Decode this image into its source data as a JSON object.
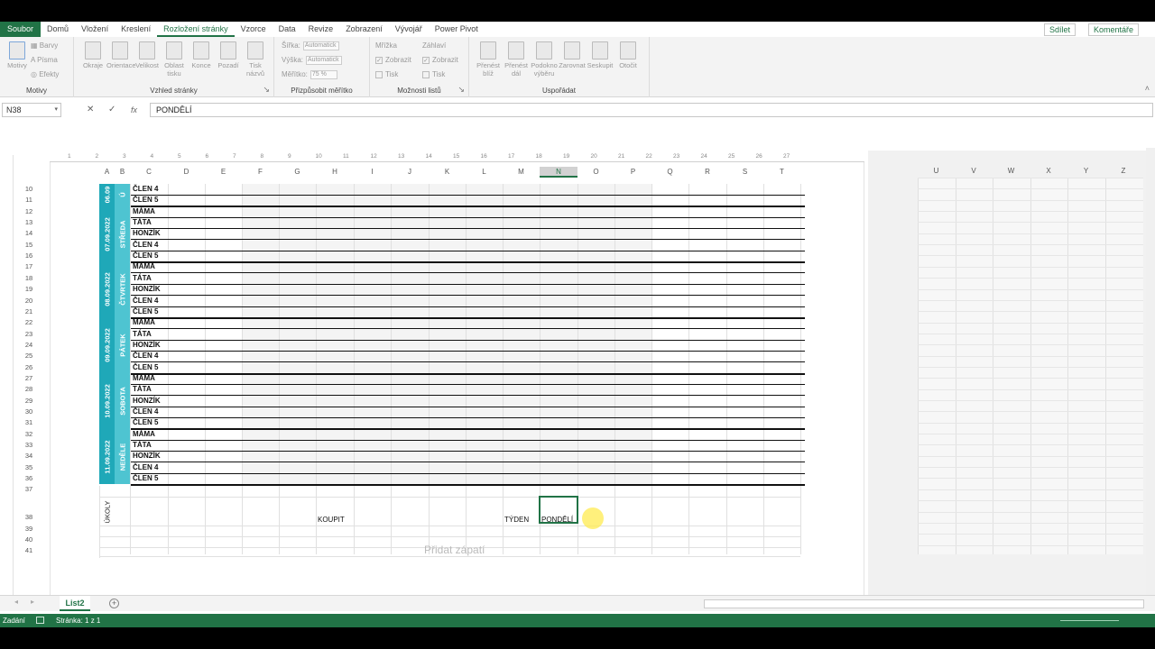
{
  "tabs": [
    "Soubor",
    "Domů",
    "Vložení",
    "Kreslení",
    "Rozložení stránky",
    "Vzorce",
    "Data",
    "Revize",
    "Zobrazení",
    "Vývojář",
    "Power Pivot"
  ],
  "actions": {
    "share": "Sdílet",
    "comments": "Komentáře"
  },
  "ribbon": {
    "motivy": {
      "label": "Motivy",
      "big": "Motivy",
      "colors": "Barvy",
      "fonts": "Písma",
      "effects": "Efekty"
    },
    "vzhled": {
      "label": "Vzhled stránky",
      "buttons": [
        "Okraje",
        "Orientace",
        "Velikost",
        "Oblast tisku",
        "Konce",
        "Pozadí",
        "Tisk názvů"
      ]
    },
    "meritko": {
      "label": "Přizpůsobit měřítko",
      "width": "Šířka:",
      "height": "Výška:",
      "scale": "Měřítko:",
      "auto": "Automatick",
      "scale_val": "75 %"
    },
    "moznosti": {
      "label": "Možnosti listů",
      "grid": "Mřížka",
      "headings": "Záhlaví",
      "view": "Zobrazit",
      "print": "Tisk"
    },
    "usporadat": {
      "label": "Uspořádat",
      "buttons": [
        "Přenést blíž",
        "Přenést dál",
        "Podokno výběru",
        "Zarovnat",
        "Seskupit",
        "Otočit"
      ]
    }
  },
  "formula": {
    "namebox": "N38",
    "content": "PONDĚLÍ",
    "cancel": "✕",
    "enter": "✓",
    "fx": "fx"
  },
  "columns": [
    "A",
    "B",
    "C",
    "D",
    "E",
    "F",
    "G",
    "H",
    "I",
    "J",
    "K",
    "L",
    "M",
    "N",
    "O",
    "P",
    "Q",
    "R",
    "S",
    "T"
  ],
  "right_columns": [
    "U",
    "V",
    "W",
    "X",
    "Y",
    "Z"
  ],
  "rows": [
    "10",
    "11",
    "12",
    "13",
    "14",
    "15",
    "16",
    "17",
    "18",
    "19",
    "20",
    "21",
    "22",
    "23",
    "24",
    "25",
    "26",
    "27",
    "28",
    "29",
    "30",
    "31",
    "32",
    "33",
    "34",
    "35",
    "36",
    "37",
    "38",
    "39",
    "40",
    "41"
  ],
  "ruler": [
    "1",
    "2",
    "3",
    "4",
    "5",
    "6",
    "7",
    "8",
    "9",
    "10",
    "11",
    "12",
    "13",
    "14",
    "15",
    "16",
    "17",
    "18",
    "19",
    "20",
    "21",
    "22",
    "23",
    "24",
    "25",
    "26",
    "27"
  ],
  "days": [
    {
      "date": "06.09",
      "name": "Ú",
      "members": [
        "ČLEN 4",
        "ČLEN 5"
      ]
    },
    {
      "date": "07.09.2022",
      "name": "STŘEDA",
      "members": [
        "MÁMA",
        "TÁTA",
        "HONZÍK",
        "ČLEN 4",
        "ČLEN 5"
      ]
    },
    {
      "date": "08.09.2022",
      "name": "ČTVRTEK",
      "members": [
        "MÁMA",
        "TÁTA",
        "HONZÍK",
        "ČLEN 4",
        "ČLEN 5"
      ]
    },
    {
      "date": "09.09.2022",
      "name": "PÁTEK",
      "members": [
        "MÁMA",
        "TÁTA",
        "HONZÍK",
        "ČLEN 4",
        "ČLEN 5"
      ]
    },
    {
      "date": "10.09.2022",
      "name": "SOBOTA",
      "members": [
        "MÁMA",
        "TÁTA",
        "HONZÍK",
        "ČLEN 4",
        "ČLEN 5"
      ]
    },
    {
      "date": "11.09.2022",
      "name": "NEDĚLE",
      "members": [
        "MÁMA",
        "TÁTA",
        "HONZÍK",
        "ČLEN 4",
        "ČLEN 5"
      ]
    }
  ],
  "bottom": {
    "ukoly": "ÚKOLY",
    "koupit": "KOUPIT",
    "tyden": "TÝDEN",
    "pondeli": "PONDĚLÍ"
  },
  "footer_placeholder": "Přidat zápatí",
  "sheet": {
    "name": "List2",
    "add": "+"
  },
  "status": {
    "mode": "Zadání",
    "page": "Stránka: 1 z 1"
  },
  "colors": {
    "accent": "#217346",
    "day_dark": "#1fa8b8",
    "day_light": "#4ec4d1"
  }
}
